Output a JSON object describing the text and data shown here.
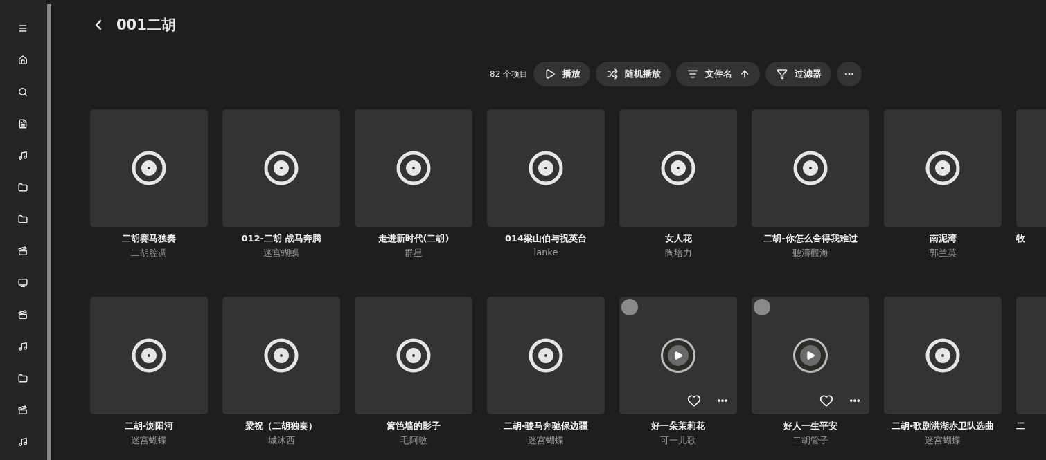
{
  "header": {
    "title": "001二胡"
  },
  "toolbar": {
    "count": "82 个项目",
    "buttons": [
      {
        "kind": "play",
        "label": "播放"
      },
      {
        "kind": "shuffle",
        "label": "随机播放"
      },
      {
        "kind": "sort",
        "label": "文件名",
        "ascending": true
      },
      {
        "kind": "filter",
        "label": "过滤器"
      },
      {
        "kind": "more"
      }
    ]
  },
  "rows": [
    {
      "items": [
        {
          "kind": "disc",
          "title": "二胡赛马独奏",
          "artist": "二胡腔调"
        },
        {
          "kind": "disc",
          "title": "012-二胡 战马奔腾",
          "artist": "迷宫蝴蝶"
        },
        {
          "kind": "disc",
          "title": "走进新时代(二胡)",
          "artist": "群星"
        },
        {
          "kind": "disc",
          "title": "014梁山伯与祝英台",
          "artist": "lanke"
        },
        {
          "kind": "disc",
          "title": "女人花",
          "artist": "陶培力"
        },
        {
          "kind": "disc",
          "title": "二胡-你怎么舍得我难过",
          "artist": "聽濤觀海"
        },
        {
          "kind": "disc",
          "title": "南泥湾",
          "artist": "郭兰英"
        },
        {
          "kind": "partial",
          "title": "牧"
        }
      ]
    },
    {
      "items": [
        {
          "kind": "disc",
          "title": "二胡-浏阳河",
          "artist": "迷宫蝴蝶"
        },
        {
          "kind": "disc",
          "title": "梁祝（二胡独奏）",
          "artist": "城沐西"
        },
        {
          "kind": "disc",
          "title": "篱笆墙的影子",
          "artist": "毛阿敏"
        },
        {
          "kind": "disc",
          "title": "二胡-骏马奔驰保边疆",
          "artist": "迷宫蝴蝶"
        },
        {
          "kind": "hover",
          "title": "好一朵茉莉花",
          "artist": "可一儿歌"
        },
        {
          "kind": "hover",
          "title": "好人一生平安",
          "artist": "二胡管子"
        },
        {
          "kind": "disc",
          "title": "二胡-歌剧洪湖赤卫队选曲",
          "artist": "迷宫蝴蝶"
        },
        {
          "kind": "partial",
          "title": "二"
        }
      ]
    }
  ]
}
